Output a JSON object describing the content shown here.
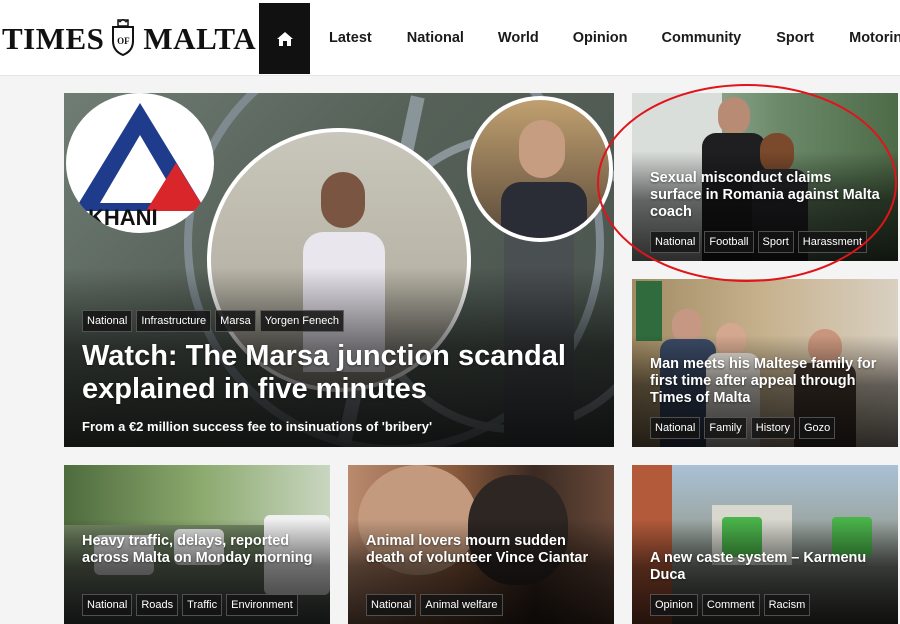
{
  "header": {
    "logo_left": "TIMES",
    "logo_crest": "OF",
    "logo_right": "MALTA",
    "home_icon": "home-icon",
    "nav": [
      "Latest",
      "National",
      "World",
      "Opinion",
      "Community",
      "Sport",
      "Motoring"
    ]
  },
  "featured": {
    "title": "Watch: The Marsa junction scandal explained in five minutes",
    "subtitle": "From a €2 million success fee to insinuations of 'bribery'",
    "tags": [
      "National",
      "Infrastructure",
      "Marsa",
      "Yorgen Fenech"
    ],
    "logo_text": "KHANI"
  },
  "side_top": {
    "title": "Sexual misconduct claims surface in Romania against Malta coach",
    "tags": [
      "National",
      "Football",
      "Sport",
      "Harassment"
    ]
  },
  "side_mid": {
    "title": "Man meets his Maltese family for first time after appeal through Times of Malta",
    "tags": [
      "National",
      "Family",
      "History",
      "Gozo"
    ]
  },
  "bottom": [
    {
      "title": "Heavy traffic, delays, reported across Malta on Monday morning",
      "tags": [
        "National",
        "Roads",
        "Traffic",
        "Environment"
      ]
    },
    {
      "title": "Animal lovers mourn sudden death of volunteer Vince Ciantar",
      "tags": [
        "National",
        "Animal welfare"
      ]
    },
    {
      "title": "A new caste system – Karmenu Duca",
      "tags": [
        "Opinion",
        "Comment",
        "Racism"
      ]
    }
  ],
  "colors": {
    "annotation": "#e0141a",
    "header_bg": "#ffffff",
    "home_bg": "#111111"
  }
}
